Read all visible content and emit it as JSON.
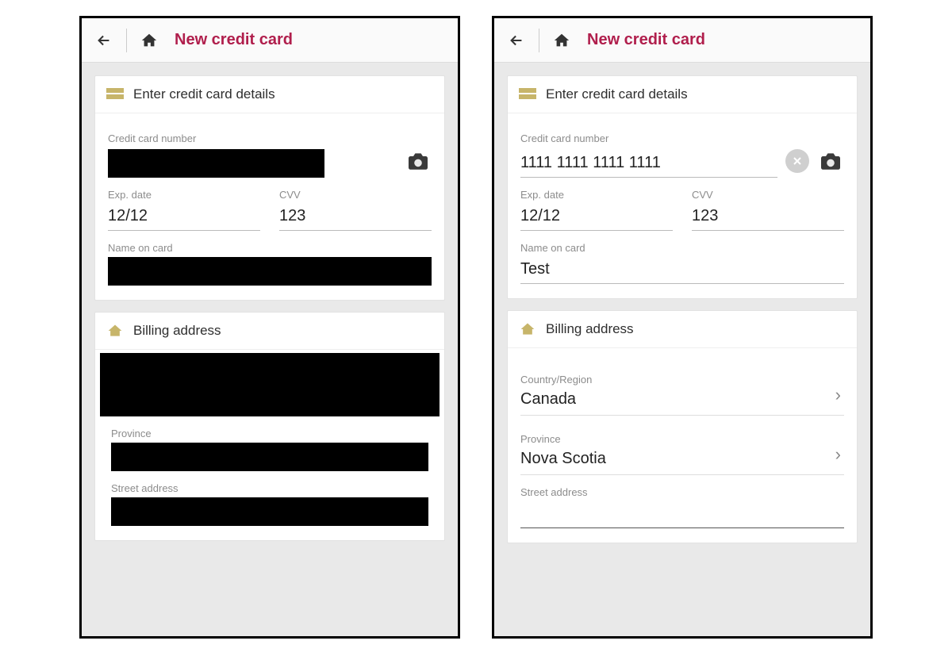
{
  "left": {
    "header": {
      "title": "New credit card"
    },
    "sections": {
      "credit": {
        "title": "Enter credit card details",
        "cc_label": "Credit card number",
        "cc_redacted": true,
        "exp_label": "Exp. date",
        "exp_value": "12/12",
        "cvv_label": "CVV",
        "cvv_value": "123",
        "name_label": "Name on card",
        "name_redacted": true
      },
      "billing": {
        "title": "Billing address",
        "block1_redacted": true,
        "province_label": "Province",
        "province_redacted": true,
        "street_label": "Street address",
        "street_redacted": true
      }
    }
  },
  "right": {
    "header": {
      "title": "New credit card"
    },
    "sections": {
      "credit": {
        "title": "Enter credit card details",
        "cc_label": "Credit card number",
        "cc_value": "1111 1111 1111 1111",
        "exp_label": "Exp. date",
        "exp_value": "12/12",
        "cvv_label": "CVV",
        "cvv_value": "123",
        "name_label": "Name on card",
        "name_value": "Test"
      },
      "billing": {
        "title": "Billing address",
        "country_label": "Country/Region",
        "country_value": "Canada",
        "province_label": "Province",
        "province_value": "Nova Scotia",
        "street_label": "Street address",
        "street_value": ""
      }
    }
  }
}
